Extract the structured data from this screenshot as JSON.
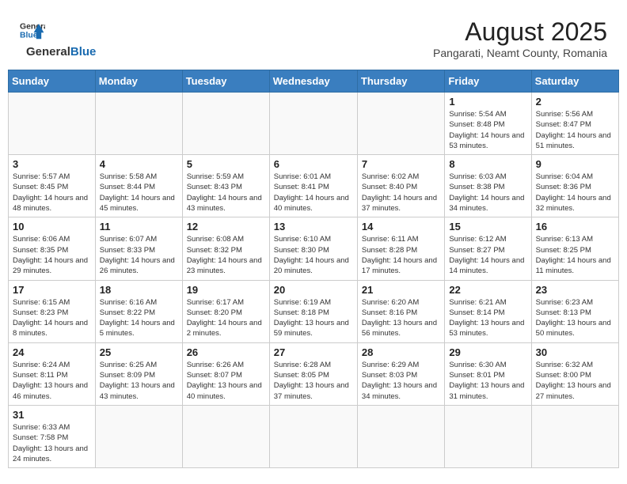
{
  "header": {
    "logo_general": "General",
    "logo_blue": "Blue",
    "month_year": "August 2025",
    "location": "Pangarati, Neamt County, Romania"
  },
  "weekdays": [
    "Sunday",
    "Monday",
    "Tuesday",
    "Wednesday",
    "Thursday",
    "Friday",
    "Saturday"
  ],
  "weeks": [
    [
      {
        "day": "",
        "info": ""
      },
      {
        "day": "",
        "info": ""
      },
      {
        "day": "",
        "info": ""
      },
      {
        "day": "",
        "info": ""
      },
      {
        "day": "",
        "info": ""
      },
      {
        "day": "1",
        "info": "Sunrise: 5:54 AM\nSunset: 8:48 PM\nDaylight: 14 hours and 53 minutes."
      },
      {
        "day": "2",
        "info": "Sunrise: 5:56 AM\nSunset: 8:47 PM\nDaylight: 14 hours and 51 minutes."
      }
    ],
    [
      {
        "day": "3",
        "info": "Sunrise: 5:57 AM\nSunset: 8:45 PM\nDaylight: 14 hours and 48 minutes."
      },
      {
        "day": "4",
        "info": "Sunrise: 5:58 AM\nSunset: 8:44 PM\nDaylight: 14 hours and 45 minutes."
      },
      {
        "day": "5",
        "info": "Sunrise: 5:59 AM\nSunset: 8:43 PM\nDaylight: 14 hours and 43 minutes."
      },
      {
        "day": "6",
        "info": "Sunrise: 6:01 AM\nSunset: 8:41 PM\nDaylight: 14 hours and 40 minutes."
      },
      {
        "day": "7",
        "info": "Sunrise: 6:02 AM\nSunset: 8:40 PM\nDaylight: 14 hours and 37 minutes."
      },
      {
        "day": "8",
        "info": "Sunrise: 6:03 AM\nSunset: 8:38 PM\nDaylight: 14 hours and 34 minutes."
      },
      {
        "day": "9",
        "info": "Sunrise: 6:04 AM\nSunset: 8:36 PM\nDaylight: 14 hours and 32 minutes."
      }
    ],
    [
      {
        "day": "10",
        "info": "Sunrise: 6:06 AM\nSunset: 8:35 PM\nDaylight: 14 hours and 29 minutes."
      },
      {
        "day": "11",
        "info": "Sunrise: 6:07 AM\nSunset: 8:33 PM\nDaylight: 14 hours and 26 minutes."
      },
      {
        "day": "12",
        "info": "Sunrise: 6:08 AM\nSunset: 8:32 PM\nDaylight: 14 hours and 23 minutes."
      },
      {
        "day": "13",
        "info": "Sunrise: 6:10 AM\nSunset: 8:30 PM\nDaylight: 14 hours and 20 minutes."
      },
      {
        "day": "14",
        "info": "Sunrise: 6:11 AM\nSunset: 8:28 PM\nDaylight: 14 hours and 17 minutes."
      },
      {
        "day": "15",
        "info": "Sunrise: 6:12 AM\nSunset: 8:27 PM\nDaylight: 14 hours and 14 minutes."
      },
      {
        "day": "16",
        "info": "Sunrise: 6:13 AM\nSunset: 8:25 PM\nDaylight: 14 hours and 11 minutes."
      }
    ],
    [
      {
        "day": "17",
        "info": "Sunrise: 6:15 AM\nSunset: 8:23 PM\nDaylight: 14 hours and 8 minutes."
      },
      {
        "day": "18",
        "info": "Sunrise: 6:16 AM\nSunset: 8:22 PM\nDaylight: 14 hours and 5 minutes."
      },
      {
        "day": "19",
        "info": "Sunrise: 6:17 AM\nSunset: 8:20 PM\nDaylight: 14 hours and 2 minutes."
      },
      {
        "day": "20",
        "info": "Sunrise: 6:19 AM\nSunset: 8:18 PM\nDaylight: 13 hours and 59 minutes."
      },
      {
        "day": "21",
        "info": "Sunrise: 6:20 AM\nSunset: 8:16 PM\nDaylight: 13 hours and 56 minutes."
      },
      {
        "day": "22",
        "info": "Sunrise: 6:21 AM\nSunset: 8:14 PM\nDaylight: 13 hours and 53 minutes."
      },
      {
        "day": "23",
        "info": "Sunrise: 6:23 AM\nSunset: 8:13 PM\nDaylight: 13 hours and 50 minutes."
      }
    ],
    [
      {
        "day": "24",
        "info": "Sunrise: 6:24 AM\nSunset: 8:11 PM\nDaylight: 13 hours and 46 minutes."
      },
      {
        "day": "25",
        "info": "Sunrise: 6:25 AM\nSunset: 8:09 PM\nDaylight: 13 hours and 43 minutes."
      },
      {
        "day": "26",
        "info": "Sunrise: 6:26 AM\nSunset: 8:07 PM\nDaylight: 13 hours and 40 minutes."
      },
      {
        "day": "27",
        "info": "Sunrise: 6:28 AM\nSunset: 8:05 PM\nDaylight: 13 hours and 37 minutes."
      },
      {
        "day": "28",
        "info": "Sunrise: 6:29 AM\nSunset: 8:03 PM\nDaylight: 13 hours and 34 minutes."
      },
      {
        "day": "29",
        "info": "Sunrise: 6:30 AM\nSunset: 8:01 PM\nDaylight: 13 hours and 31 minutes."
      },
      {
        "day": "30",
        "info": "Sunrise: 6:32 AM\nSunset: 8:00 PM\nDaylight: 13 hours and 27 minutes."
      }
    ],
    [
      {
        "day": "31",
        "info": "Sunrise: 6:33 AM\nSunset: 7:58 PM\nDaylight: 13 hours and 24 minutes."
      },
      {
        "day": "",
        "info": ""
      },
      {
        "day": "",
        "info": ""
      },
      {
        "day": "",
        "info": ""
      },
      {
        "day": "",
        "info": ""
      },
      {
        "day": "",
        "info": ""
      },
      {
        "day": "",
        "info": ""
      }
    ]
  ]
}
